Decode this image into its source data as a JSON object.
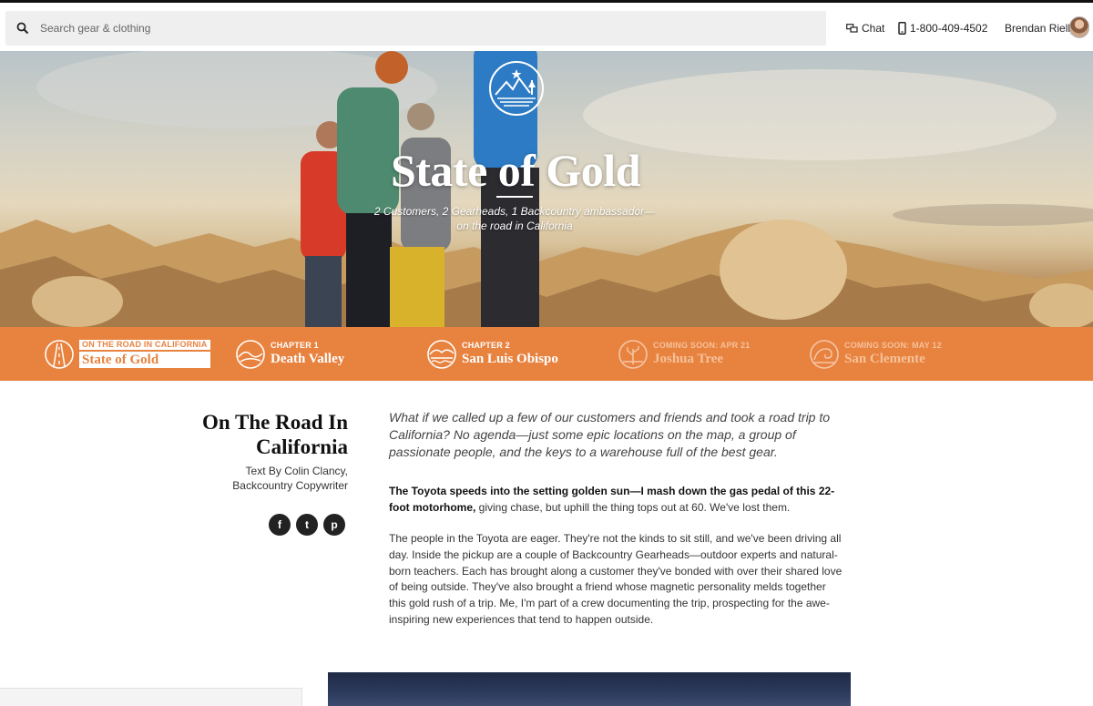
{
  "search": {
    "placeholder": "Search gear & clothing"
  },
  "header": {
    "chat_label": "Chat",
    "phone": "1-800-409-4502",
    "user_name": "Brendan Rielly"
  },
  "hero": {
    "title": "State of Gold",
    "subtitle_line1": "2 Customers, 2 Gearheads, 1 Backcountry ambassador—",
    "subtitle_line2": "on the road in California"
  },
  "chapters": [
    {
      "kicker": "ON THE ROAD IN CALIFORNIA",
      "name": "State of Gold",
      "state": "active"
    },
    {
      "kicker": "CHAPTER 1",
      "name": "Death Valley",
      "state": "available"
    },
    {
      "kicker": "CHAPTER 2",
      "name": "San Luis Obispo",
      "state": "available"
    },
    {
      "kicker": "COMING SOON: APR 21",
      "name": "Joshua Tree",
      "state": "soon"
    },
    {
      "kicker": "COMING SOON: MAY 12",
      "name": "San Clemente",
      "state": "soon"
    }
  ],
  "article": {
    "title_line1": "On The Road In",
    "title_line2": "California",
    "byline_line1": "Text By Colin Clancy,",
    "byline_line2": "Backcountry Copywriter",
    "social": [
      {
        "icon": "facebook-icon",
        "glyph": "f"
      },
      {
        "icon": "twitter-icon",
        "glyph": "t"
      },
      {
        "icon": "pinterest-icon",
        "glyph": "p"
      }
    ],
    "intro": "What if we called up a few of our customers and friends and took a road trip to California? No agenda—just some epic locations on the map, a group of passionate people, and the keys to a warehouse full of the best gear.",
    "para1_bold": "The Toyota speeds into the setting golden sun—I mash down the gas pedal of this 22-foot motorhome,",
    "para1_rest": " giving chase, but uphill the thing tops out at 60. We've lost them.",
    "para2": "The people in the Toyota are eager. They're not the kinds to sit still, and we've been driving all day. Inside the pickup are a couple of Backcountry Gearheads—outdoor experts and natural-born teachers. Each has brought along a customer they've bonded with over their shared love of being outside. They've also brought a friend whose magnetic personality melds together this gold rush of a trip. Me, I'm part of a crew documenting the trip, prospecting for the awe-inspiring new experiences that tend to happen outside."
  },
  "colors": {
    "accent": "#e8823f",
    "text": "#222222",
    "search_bg": "#efefef"
  }
}
